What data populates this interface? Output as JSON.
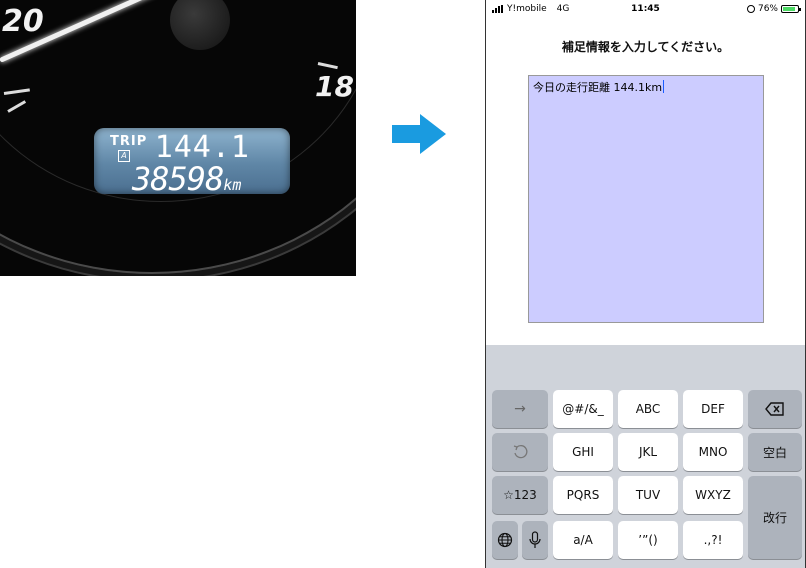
{
  "photo": {
    "speedo_left_number": "20",
    "speedo_right_number": "18",
    "trip_label": "TRIP",
    "trip_sub_label": "A",
    "trip_value": "144.1",
    "odometer_value": "38598",
    "odometer_unit": "km"
  },
  "arrow": {
    "icon": "right-arrow-icon",
    "color": "#1a9be0"
  },
  "phone": {
    "status": {
      "carrier": "Y!mobile",
      "network": "4G",
      "time": "11:45",
      "battery": "76%"
    },
    "heading": "補足情報を入力してください。",
    "input": {
      "value": "今日の走行距離 144.1km"
    },
    "keyboard": {
      "row1": [
        "→",
        "@#/&_",
        "ABC",
        "DEF",
        "delete-icon"
      ],
      "row2": [
        "undo-icon",
        "GHI",
        "JKL",
        "MNO",
        "空白"
      ],
      "row3": [
        "☆123",
        "PQRS",
        "TUV",
        "WXYZ",
        "改行"
      ],
      "row4": [
        "globe-icon",
        "mic-icon",
        "a/A",
        "’”()",
        ".,?!"
      ],
      "labels": {
        "arrow": "→",
        "sym": "@#/&_",
        "abc": "ABC",
        "def": "DEF",
        "ghi": "GHI",
        "jkl": "JKL",
        "mno": "MNO",
        "space": "空白",
        "num": "☆123",
        "pqrs": "PQRS",
        "tuv": "TUV",
        "wxyz": "WXYZ",
        "enter": "改行",
        "case": "a/A",
        "quotes": "’”()",
        "punct": ".,?!"
      }
    }
  }
}
